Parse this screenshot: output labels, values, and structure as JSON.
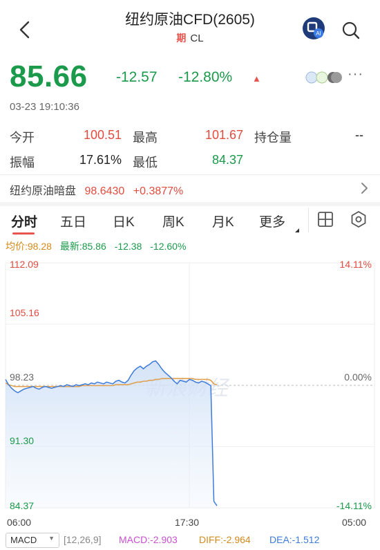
{
  "header": {
    "title": "纽约原油CFD(2605)",
    "type_badge": "期",
    "symbol": "CL",
    "ai_label": "AI"
  },
  "quote": {
    "price": "85.66",
    "change": "-12.57",
    "change_pct": "-12.80%",
    "arrow": "▲",
    "more": "···",
    "timestamp": "03-23 19:10:36"
  },
  "stats": {
    "open_label": "今开",
    "open": "100.51",
    "high_label": "最高",
    "high": "101.67",
    "oi_label": "持仓量",
    "oi": "--",
    "amp_label": "振幅",
    "amp": "17.61%",
    "low_label": "最低",
    "low": "84.37"
  },
  "dark_pool": {
    "label": "纽约原油暗盘",
    "price": "98.6430",
    "change_pct": "+0.3877%"
  },
  "tabs": [
    "分时",
    "五日",
    "日K",
    "周K",
    "月K",
    "更多"
  ],
  "legend": {
    "avg": "均价:98.28",
    "latest": "最新:85.86",
    "chg": "-12.38",
    "chg_pct": "-12.60%"
  },
  "chart_data": {
    "type": "line",
    "y_left_ticks": [
      "112.09",
      "105.16",
      "98.23",
      "91.30",
      "84.37"
    ],
    "y_right_ticks": [
      "14.11%",
      "0.00%",
      "-14.11%"
    ],
    "x_ticks": [
      "06:00",
      "17:30",
      "05:00"
    ],
    "ylim": [
      84.37,
      112.09
    ],
    "reference": 98.23,
    "watermark": "新浪财经",
    "series": [
      {
        "values": [
          98.9,
          98.3,
          97.9,
          97.6,
          97.4,
          97.6,
          97.8,
          97.9,
          98.0,
          98.1,
          97.9,
          97.8,
          98.0,
          98.1,
          98.0,
          97.9,
          98.0,
          98.1,
          98.2,
          98.1,
          98.3,
          98.2,
          98.1,
          98.3,
          98.2,
          98.3,
          98.4,
          98.3,
          98.5,
          98.4,
          98.6,
          98.5,
          98.4,
          98.6,
          98.5,
          98.4,
          98.7,
          98.8,
          98.6,
          98.5,
          98.8,
          99.4,
          99.9,
          100.2,
          100.4,
          100.1,
          100.4,
          100.6,
          100.9,
          101.0,
          100.6,
          100.1,
          99.7,
          99.4,
          99.1,
          98.7,
          98.4,
          98.8,
          98.7,
          98.6,
          98.9,
          98.8,
          98.6,
          98.5,
          98.7,
          98.6,
          98.4,
          98.2,
          85.1,
          84.6
        ]
      },
      {
        "values": [
          98.5,
          98.3,
          98.2,
          98.1,
          98.1,
          98.1,
          98.1,
          98.1,
          98.1,
          98.1,
          98.1,
          98.1,
          98.1,
          98.1,
          98.1,
          98.1,
          98.1,
          98.1,
          98.1,
          98.1,
          98.1,
          98.1,
          98.1,
          98.1,
          98.1,
          98.2,
          98.2,
          98.2,
          98.2,
          98.2,
          98.2,
          98.2,
          98.2,
          98.2,
          98.2,
          98.2,
          98.3,
          98.3,
          98.3,
          98.3,
          98.3,
          98.4,
          98.5,
          98.6,
          98.6,
          98.7,
          98.7,
          98.8,
          98.8,
          98.9,
          98.9,
          99.0,
          99.0,
          99.0,
          99.0,
          99.0,
          99.0,
          99.0,
          99.0,
          99.0,
          99.0,
          99.0,
          98.9,
          98.9,
          98.9,
          98.9,
          98.9,
          98.8,
          98.4,
          98.28
        ]
      }
    ]
  },
  "macd": {
    "selector": "MACD",
    "params": "[12,26,9]",
    "macd": "MACD:-2.903",
    "diff": "DIFF:-2.964",
    "dea": "DEA:-1.512"
  },
  "colors": {
    "up": "#e04b3e",
    "down": "#1a9a4a",
    "avg_line": "#e0a050",
    "price_line": "#3d7bd9"
  }
}
